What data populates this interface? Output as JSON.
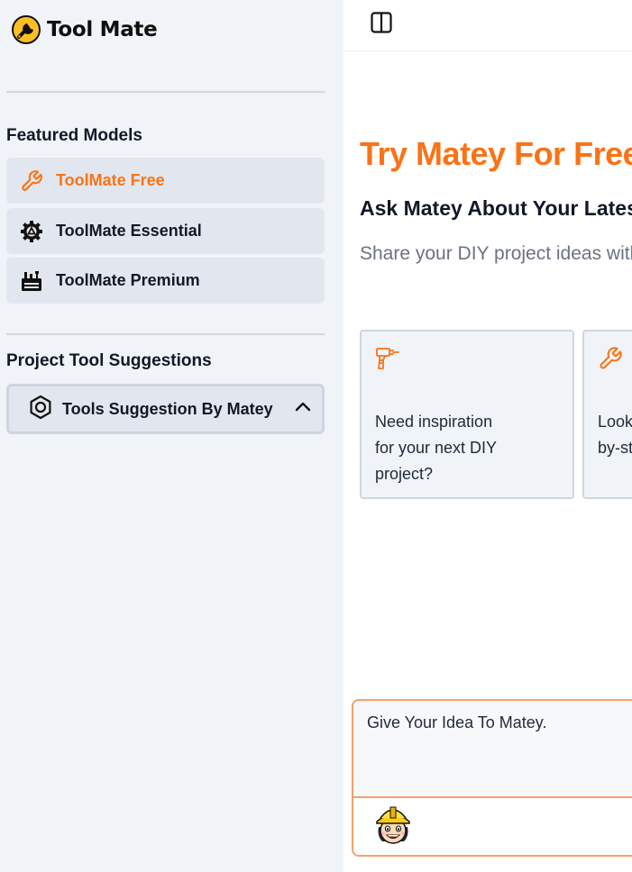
{
  "brand": {
    "name": "Tool Mate",
    "logo_icon": "wrench-badge-icon"
  },
  "sidebar": {
    "featured_title": "Featured Models",
    "models": [
      {
        "label": "ToolMate Free",
        "icon": "wrench-icon",
        "active": true
      },
      {
        "label": "ToolMate Essential",
        "icon": "gear-icon",
        "active": false
      },
      {
        "label": "ToolMate Premium",
        "icon": "toolbox-icon",
        "active": false
      }
    ],
    "suggestions_title": "Project Tool Suggestions",
    "suggestions_button": {
      "label": "Tools Suggestion By Matey",
      "icon": "hexagon-nut-icon",
      "chevron": "chevron-up-icon"
    }
  },
  "topbar": {
    "toggle_icon": "sidebar-toggle-icon"
  },
  "hero": {
    "title": "Try Matey For Free",
    "subtitle": "Ask Matey About Your Latest Project",
    "description": "Share your DIY project ideas with Matey"
  },
  "cards": [
    {
      "text": "Need inspiration\nfor your next DIY\nproject?",
      "icon": "drill-icon"
    },
    {
      "text": "Looking for step-\nby-step guides?",
      "icon": "wrench-icon"
    }
  ],
  "composer": {
    "placeholder": "Give Your Idea To Matey.",
    "avatar": "matey-avatar"
  },
  "colors": {
    "accent": "#f97316",
    "sidebar_bg": "#f0f3f8",
    "item_bg": "#e2e7ef"
  }
}
